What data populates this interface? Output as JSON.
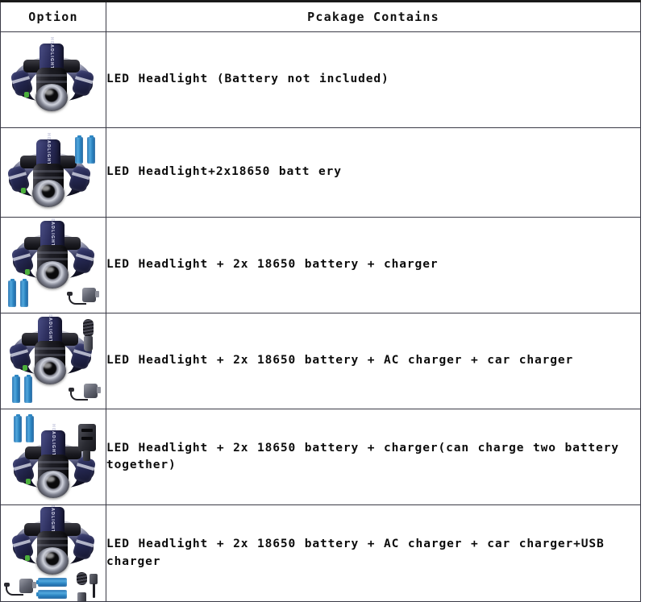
{
  "table": {
    "headers": {
      "option": "Option",
      "package": "Pcakage Contains"
    },
    "rows": [
      {
        "index": 1,
        "description": "LED Headlight (Battery not included)",
        "contents": [
          "headlamp"
        ]
      },
      {
        "index": 2,
        "description": "LED Headlight+2x18650 batt ery",
        "contents": [
          "headlamp",
          "2x-18650-battery"
        ]
      },
      {
        "index": 3,
        "description": "LED Headlight + 2x 18650 battery + charger",
        "contents": [
          "headlamp",
          "2x-18650-battery",
          "ac-charger"
        ]
      },
      {
        "index": 4,
        "description": "LED Headlight + 2x 18650 battery + AC charger + car charger",
        "contents": [
          "headlamp",
          "2x-18650-battery",
          "ac-charger",
          "car-charger"
        ]
      },
      {
        "index": 5,
        "description": "LED Headlight + 2x 18650 battery + charger(can charge two battery together)",
        "contents": [
          "headlamp",
          "2x-18650-battery",
          "dual-charger"
        ]
      },
      {
        "index": 6,
        "description": "LED Headlight + 2x 18650 battery + AC charger + car charger+USB charger",
        "contents": [
          "headlamp",
          "2x-18650-battery",
          "ac-charger",
          "car-charger",
          "usb-charger"
        ]
      }
    ]
  },
  "product": {
    "brand_text": "HEADLIGHT"
  },
  "colors": {
    "border": "#3a3a46",
    "top_border": "#1a1a1a",
    "text": "#0c0c0c",
    "background": "#ffffff",
    "battery_blue": "#2e87c4",
    "lamp_navy": "#242750",
    "lamp_black": "#17171c",
    "indicator_green": "#4caf3c"
  }
}
